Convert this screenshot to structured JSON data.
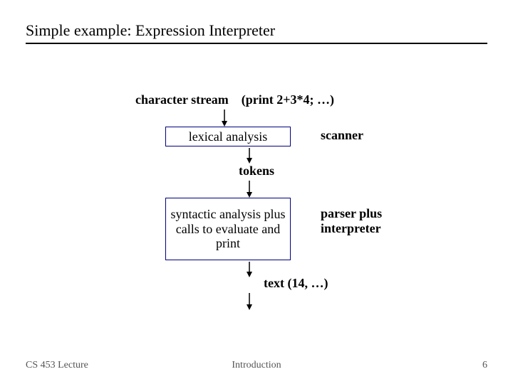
{
  "title": "Simple example: Expression Interpreter",
  "input": {
    "label": "character stream",
    "example": "(print 2+3*4; …)"
  },
  "stage1": {
    "box": "lexical analysis",
    "side": "scanner"
  },
  "mid_label": "tokens",
  "stage2": {
    "box": "syntactic analysis plus calls to evaluate and print",
    "side_line1": "parser plus",
    "side_line2": "interpreter"
  },
  "output": {
    "label": "text  (14, …)"
  },
  "footer": {
    "left": "CS 453 Lecture",
    "center": "Introduction",
    "right": "6"
  },
  "colors": {
    "box_border": "#000080"
  }
}
